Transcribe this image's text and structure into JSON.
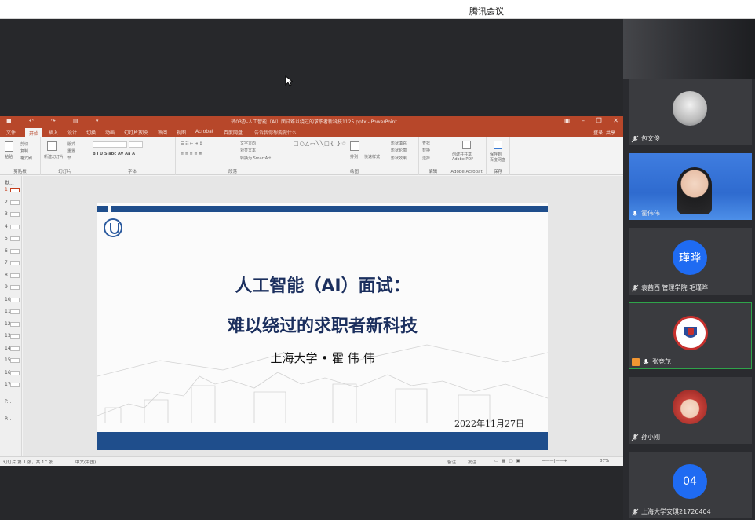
{
  "app": {
    "title": "腾讯会议"
  },
  "ppt": {
    "doc_title": "转03办-人工智能（AI）面试难以绕过的求职者新科技1125.pptx - PowerPoint",
    "tabs": [
      "文件",
      "开始",
      "插入",
      "设计",
      "切换",
      "动画",
      "幻灯片放映",
      "审阅",
      "视图",
      "Acrobat",
      "百度网盘"
    ],
    "active_tab_index": 1,
    "tell_me": "告诉我你想要做什么...",
    "login": "登录",
    "share": "共享",
    "ribbon_groups": [
      {
        "label": "剪贴板",
        "items": [
          "粘贴",
          "剪切",
          "复制",
          "格式刷"
        ]
      },
      {
        "label": "幻灯片",
        "items": [
          "新建幻灯片",
          "版式",
          "重置",
          "节"
        ]
      },
      {
        "label": "字体",
        "items": []
      },
      {
        "label": "段落",
        "items": [
          "文字方向",
          "对齐文本",
          "转换为 SmartArt"
        ]
      },
      {
        "label": "绘图",
        "items": [
          "排列",
          "快速样式",
          "形状填充",
          "形状轮廓",
          "形状效果"
        ]
      },
      {
        "label": "编辑",
        "items": [
          "查找",
          "替换",
          "选择"
        ]
      },
      {
        "label": "Adobe Acrobat",
        "items": [
          "创建并共享",
          "Adobe PDF"
        ]
      },
      {
        "label": "保存",
        "items": [
          "保存到",
          "百度网盘"
        ]
      }
    ],
    "thumbnails": [
      "1",
      "2",
      "3",
      "4",
      "5",
      "6",
      "7",
      "8",
      "9",
      "10",
      "11",
      "12",
      "13",
      "14",
      "15",
      "16",
      "17"
    ],
    "thumb_sections": [
      "默...",
      "P...",
      "P..."
    ],
    "status": {
      "slide_info": "幻灯片 第 1 张，共 17 张",
      "language": "中文(中国)",
      "notes": "备注",
      "comments": "批注",
      "zoom": "87%"
    },
    "slide": {
      "title_line1": "人工智能（AI）面试：",
      "title_line2": "难以绕过的求职者新科技",
      "author": "上海大学 • 霍 伟 伟",
      "date": "2022年11月27日"
    }
  },
  "participants": [
    {
      "name": "包文俊",
      "avatar_type": "photo",
      "avatar_label": ""
    },
    {
      "name": "霍伟伟",
      "avatar_type": "video",
      "avatar_label": ""
    },
    {
      "name": "袁茜西 管理学院 毛瑾晔",
      "avatar_type": "initials",
      "avatar_label": "瑾晔",
      "color": "#1f6bf2"
    },
    {
      "name": "张竞茂",
      "avatar_type": "logo",
      "avatar_label": "",
      "speaking": true
    },
    {
      "name": "孙小刚",
      "avatar_type": "photo",
      "avatar_label": ""
    },
    {
      "name": "上海大学安琪21726404",
      "avatar_type": "initials",
      "avatar_label": "04",
      "color": "#1f6bf2"
    }
  ]
}
